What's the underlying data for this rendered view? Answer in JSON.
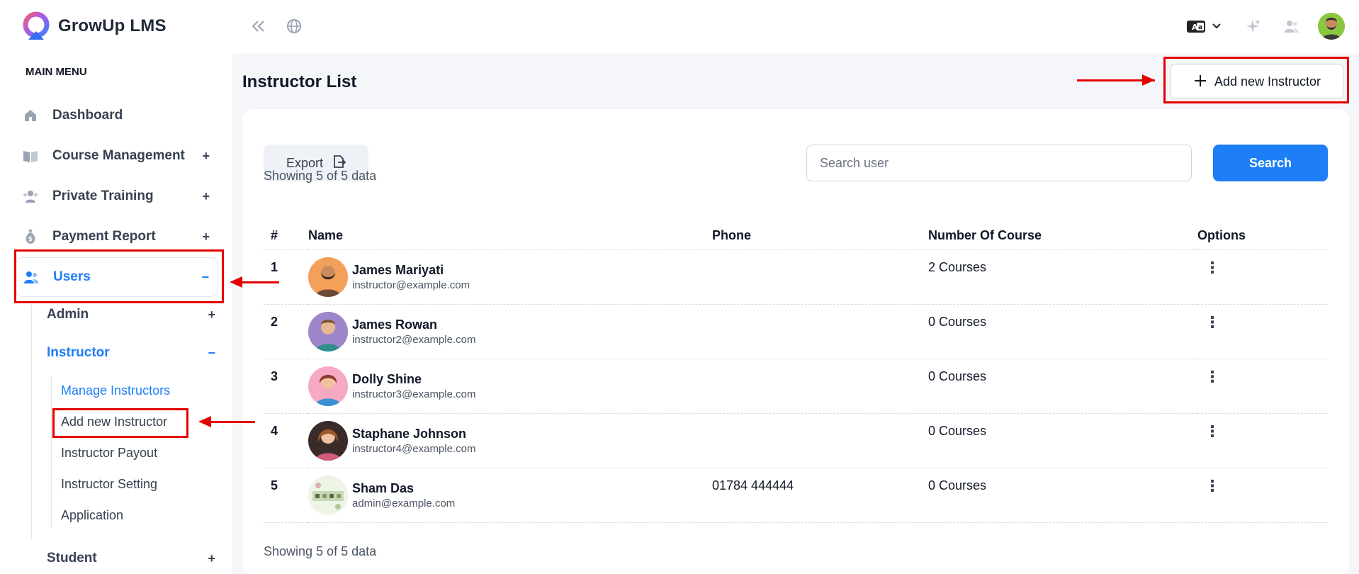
{
  "brand": {
    "name": "GrowUp LMS"
  },
  "sidebar": {
    "section_title": "MAIN MENU",
    "items": [
      {
        "label": "Dashboard",
        "icon": "home-icon",
        "toggle": ""
      },
      {
        "label": "Course Management",
        "icon": "book-icon",
        "toggle": "+"
      },
      {
        "label": "Private Training",
        "icon": "users-group-icon",
        "toggle": "+"
      },
      {
        "label": "Payment Report",
        "icon": "money-bag-icon",
        "toggle": "+"
      },
      {
        "label": "Users",
        "icon": "users-icon",
        "toggle": "−"
      }
    ],
    "users_sub": [
      {
        "label": "Admin",
        "toggle": "+"
      },
      {
        "label": "Instructor",
        "toggle": "−"
      },
      {
        "label": "Student",
        "toggle": "+"
      }
    ],
    "instructor_sub": [
      {
        "label": "Manage Instructors"
      },
      {
        "label": "Add new Instructor"
      },
      {
        "label": "Instructor Payout"
      },
      {
        "label": "Instructor Setting"
      },
      {
        "label": "Application"
      }
    ]
  },
  "header": {
    "language_icon": "translate-icon",
    "accent": "#1e7ef7"
  },
  "main": {
    "title": "Instructor List",
    "add_button_label": "Add new Instructor",
    "export_label": "Export",
    "search_placeholder": "Search user",
    "search_button_label": "Search",
    "showing_text": "Showing 5 of 5 data",
    "columns": [
      "#",
      "Name",
      "Phone",
      "Number Of Course",
      "Options"
    ],
    "rows": [
      {
        "num": "1",
        "name": "James Mariyati",
        "email": "instructor@example.com",
        "phone": "",
        "courses": "2 Courses"
      },
      {
        "num": "2",
        "name": "James Rowan",
        "email": "instructor2@example.com",
        "phone": "",
        "courses": "0 Courses"
      },
      {
        "num": "3",
        "name": "Dolly Shine",
        "email": "instructor3@example.com",
        "phone": "",
        "courses": "0 Courses"
      },
      {
        "num": "4",
        "name": "Staphane Johnson",
        "email": "instructor4@example.com",
        "phone": "",
        "courses": "0 Courses"
      },
      {
        "num": "5",
        "name": "Sham Das",
        "email": "admin@example.com",
        "phone": "01784 444444",
        "courses": "0 Courses"
      }
    ]
  }
}
